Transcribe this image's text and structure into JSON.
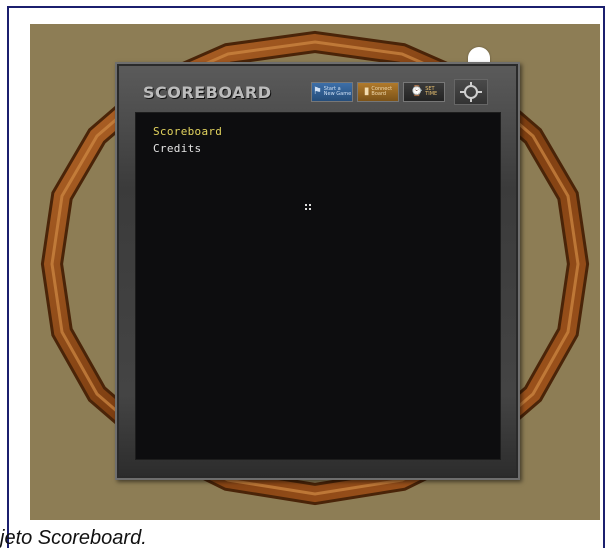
{
  "board": {
    "title": "SCOREBOARD",
    "buttons": [
      {
        "label_top": "Start a",
        "label_bottom": "New Game",
        "icon": "flag-icon",
        "color": "#2f5f95"
      },
      {
        "label_top": "Connect",
        "label_bottom": "Board",
        "icon": "plug-icon",
        "color": "#9a6a24"
      },
      {
        "label_top": "SET",
        "label_bottom": "TIME",
        "icon": "clock-icon",
        "color": "#2e2e2e"
      }
    ],
    "settings_icon": "gear-icon",
    "menu": {
      "items": [
        "Scoreboard",
        "Credits"
      ],
      "active_index": 0,
      "active_color": "#e1d25e"
    }
  },
  "caption": "jeto Scoreboard.",
  "scene": {
    "background_color": "#8d7d55",
    "ring_color": "#8a4a18"
  }
}
